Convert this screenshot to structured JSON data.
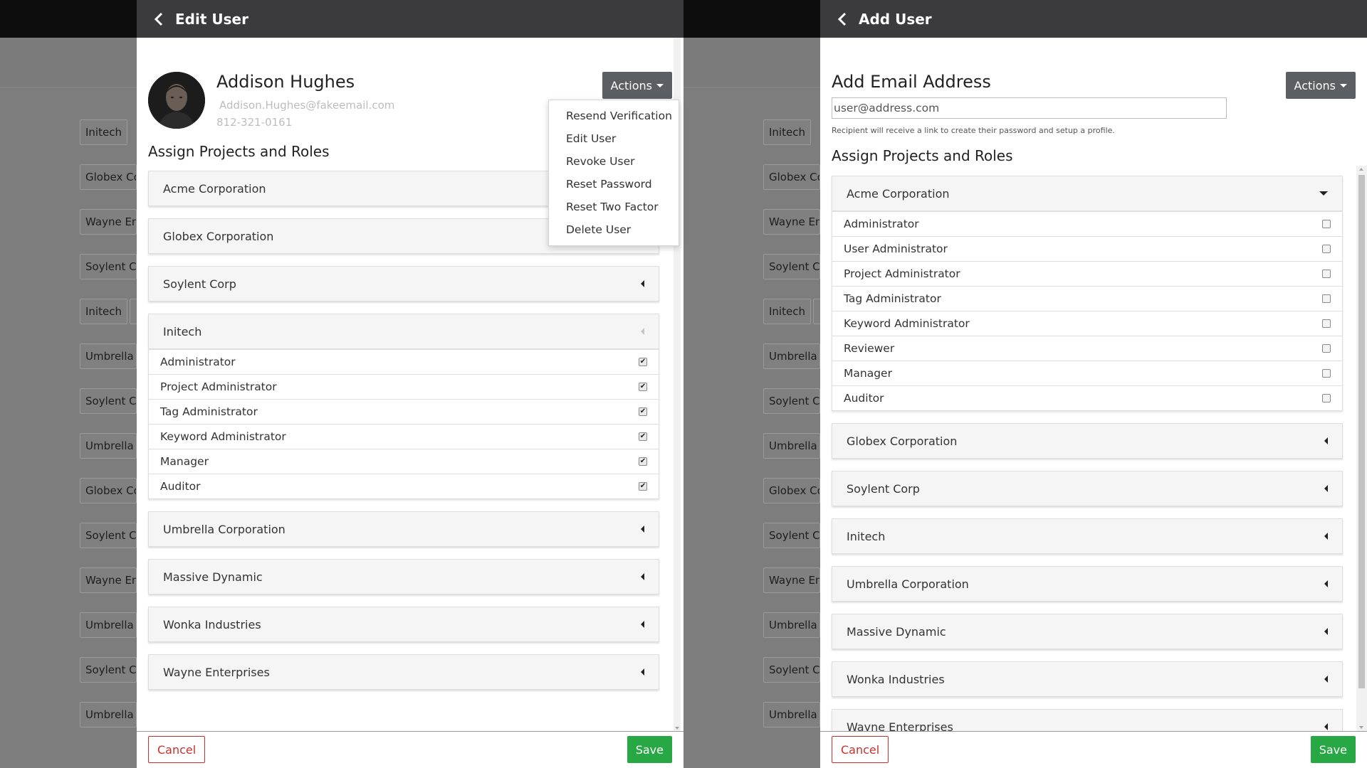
{
  "background": {
    "column_a": [
      "Initech",
      "Globex Co",
      "Wayne Ent",
      "Soylent Co",
      "Initech",
      "Umbrella C",
      "Soylent Co",
      "Umbrella C",
      "Globex Co",
      "Soylent Co",
      "Wayne Ent",
      "Umbrella C",
      "Soylent Co",
      "Umbrella C"
    ],
    "column_b": [
      "Initech",
      "Globex Co",
      "Wayne Ent",
      "Soylent Co",
      "Initech",
      "Umbrella C",
      "Soylent Co",
      "Umbrella C",
      "Globex Co",
      "Soylent Co",
      "Wayne Ent",
      "Umbrella C",
      "Soylent Co",
      "Umbrella C"
    ]
  },
  "edit_user": {
    "title": "Edit User",
    "actions_label": "Actions",
    "name": "Addison Hughes",
    "email": "Addison.Hughes@fakeemail.com",
    "phone": "812-321-0161",
    "section_title": "Assign Projects and Roles",
    "menu_items": [
      "Resend Verification",
      "Edit User",
      "Revoke User",
      "Reset Password",
      "Reset Two Factor",
      "Delete User"
    ],
    "projects": [
      {
        "name": "Acme Corporation",
        "state": "collapsed"
      },
      {
        "name": "Globex Corporation",
        "state": "collapsed"
      },
      {
        "name": "Soylent Corp",
        "state": "collapsed"
      },
      {
        "name": "Initech",
        "state": "open"
      },
      {
        "name": "Umbrella Corporation",
        "state": "collapsed"
      },
      {
        "name": "Massive Dynamic",
        "state": "collapsed"
      },
      {
        "name": "Wonka Industries",
        "state": "collapsed"
      },
      {
        "name": "Wayne Enterprises",
        "state": "collapsed"
      }
    ],
    "roles": [
      {
        "label": "Administrator",
        "checked": true
      },
      {
        "label": "Project Administrator",
        "checked": true
      },
      {
        "label": "Tag Administrator",
        "checked": true
      },
      {
        "label": "Keyword Administrator",
        "checked": true
      },
      {
        "label": "Manager",
        "checked": true
      },
      {
        "label": "Auditor",
        "checked": true
      }
    ],
    "cancel_label": "Cancel",
    "save_label": "Save"
  },
  "add_user": {
    "title": "Add User",
    "actions_label": "Actions",
    "email_heading": "Add Email Address",
    "email_placeholder": "user@address.com",
    "email_help": "Recipient will receive a link to create their password and setup a profile.",
    "section_title": "Assign Projects and Roles",
    "projects": [
      {
        "name": "Acme Corporation",
        "state": "expanded"
      },
      {
        "name": "Globex Corporation",
        "state": "collapsed"
      },
      {
        "name": "Soylent Corp",
        "state": "collapsed"
      },
      {
        "name": "Initech",
        "state": "collapsed"
      },
      {
        "name": "Umbrella Corporation",
        "state": "collapsed"
      },
      {
        "name": "Massive Dynamic",
        "state": "collapsed"
      },
      {
        "name": "Wonka Industries",
        "state": "collapsed"
      },
      {
        "name": "Wayne Enterprises",
        "state": "collapsed"
      }
    ],
    "roles": [
      {
        "label": "Administrator",
        "checked": false
      },
      {
        "label": "User Administrator",
        "checked": false
      },
      {
        "label": "Project Administrator",
        "checked": false
      },
      {
        "label": "Tag Administrator",
        "checked": false
      },
      {
        "label": "Keyword Administrator",
        "checked": false
      },
      {
        "label": "Reviewer",
        "checked": false
      },
      {
        "label": "Manager",
        "checked": false
      },
      {
        "label": "Auditor",
        "checked": false
      }
    ],
    "cancel_label": "Cancel",
    "save_label": "Save"
  },
  "colors": {
    "header": "#3b3b3e",
    "actions_button": "#5b5e63",
    "save": "#28a745",
    "cancel": "#c9302c"
  }
}
